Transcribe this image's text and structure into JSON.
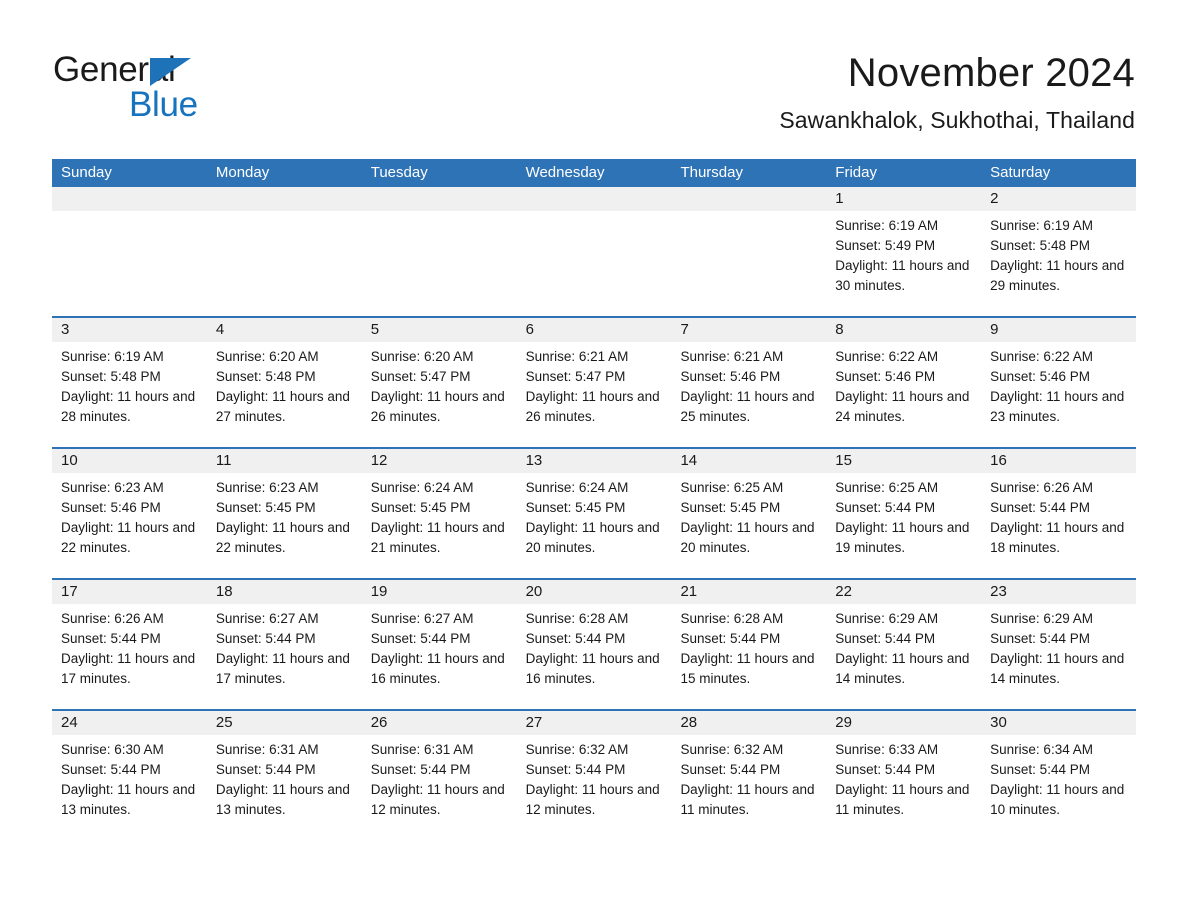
{
  "brand": {
    "name_part1": "General",
    "name_part2": "Blue",
    "logo_icon": "triangle-flag-icon"
  },
  "header": {
    "month_title": "November 2024",
    "location": "Sawankhalok, Sukhothai, Thailand"
  },
  "colors": {
    "header_blue": "#2e73b6",
    "brand_blue": "#1673be",
    "date_band_gray": "#f0f0f0",
    "text": "#1a1a1a"
  },
  "weekdays": [
    "Sunday",
    "Monday",
    "Tuesday",
    "Wednesday",
    "Thursday",
    "Friday",
    "Saturday"
  ],
  "labels": {
    "sunrise_prefix": "Sunrise:",
    "sunset_prefix": "Sunset:",
    "daylight_prefix": "Daylight:"
  },
  "weeks": [
    [
      {
        "date": "",
        "empty": true
      },
      {
        "date": "",
        "empty": true
      },
      {
        "date": "",
        "empty": true
      },
      {
        "date": "",
        "empty": true
      },
      {
        "date": "",
        "empty": true
      },
      {
        "date": "1",
        "sunrise": "Sunrise: 6:19 AM",
        "sunset": "Sunset: 5:49 PM",
        "daylight": "Daylight: 11 hours and 30 minutes."
      },
      {
        "date": "2",
        "sunrise": "Sunrise: 6:19 AM",
        "sunset": "Sunset: 5:48 PM",
        "daylight": "Daylight: 11 hours and 29 minutes."
      }
    ],
    [
      {
        "date": "3",
        "sunrise": "Sunrise: 6:19 AM",
        "sunset": "Sunset: 5:48 PM",
        "daylight": "Daylight: 11 hours and 28 minutes."
      },
      {
        "date": "4",
        "sunrise": "Sunrise: 6:20 AM",
        "sunset": "Sunset: 5:48 PM",
        "daylight": "Daylight: 11 hours and 27 minutes."
      },
      {
        "date": "5",
        "sunrise": "Sunrise: 6:20 AM",
        "sunset": "Sunset: 5:47 PM",
        "daylight": "Daylight: 11 hours and 26 minutes."
      },
      {
        "date": "6",
        "sunrise": "Sunrise: 6:21 AM",
        "sunset": "Sunset: 5:47 PM",
        "daylight": "Daylight: 11 hours and 26 minutes."
      },
      {
        "date": "7",
        "sunrise": "Sunrise: 6:21 AM",
        "sunset": "Sunset: 5:46 PM",
        "daylight": "Daylight: 11 hours and 25 minutes."
      },
      {
        "date": "8",
        "sunrise": "Sunrise: 6:22 AM",
        "sunset": "Sunset: 5:46 PM",
        "daylight": "Daylight: 11 hours and 24 minutes."
      },
      {
        "date": "9",
        "sunrise": "Sunrise: 6:22 AM",
        "sunset": "Sunset: 5:46 PM",
        "daylight": "Daylight: 11 hours and 23 minutes."
      }
    ],
    [
      {
        "date": "10",
        "sunrise": "Sunrise: 6:23 AM",
        "sunset": "Sunset: 5:46 PM",
        "daylight": "Daylight: 11 hours and 22 minutes."
      },
      {
        "date": "11",
        "sunrise": "Sunrise: 6:23 AM",
        "sunset": "Sunset: 5:45 PM",
        "daylight": "Daylight: 11 hours and 22 minutes."
      },
      {
        "date": "12",
        "sunrise": "Sunrise: 6:24 AM",
        "sunset": "Sunset: 5:45 PM",
        "daylight": "Daylight: 11 hours and 21 minutes."
      },
      {
        "date": "13",
        "sunrise": "Sunrise: 6:24 AM",
        "sunset": "Sunset: 5:45 PM",
        "daylight": "Daylight: 11 hours and 20 minutes."
      },
      {
        "date": "14",
        "sunrise": "Sunrise: 6:25 AM",
        "sunset": "Sunset: 5:45 PM",
        "daylight": "Daylight: 11 hours and 20 minutes."
      },
      {
        "date": "15",
        "sunrise": "Sunrise: 6:25 AM",
        "sunset": "Sunset: 5:44 PM",
        "daylight": "Daylight: 11 hours and 19 minutes."
      },
      {
        "date": "16",
        "sunrise": "Sunrise: 6:26 AM",
        "sunset": "Sunset: 5:44 PM",
        "daylight": "Daylight: 11 hours and 18 minutes."
      }
    ],
    [
      {
        "date": "17",
        "sunrise": "Sunrise: 6:26 AM",
        "sunset": "Sunset: 5:44 PM",
        "daylight": "Daylight: 11 hours and 17 minutes."
      },
      {
        "date": "18",
        "sunrise": "Sunrise: 6:27 AM",
        "sunset": "Sunset: 5:44 PM",
        "daylight": "Daylight: 11 hours and 17 minutes."
      },
      {
        "date": "19",
        "sunrise": "Sunrise: 6:27 AM",
        "sunset": "Sunset: 5:44 PM",
        "daylight": "Daylight: 11 hours and 16 minutes."
      },
      {
        "date": "20",
        "sunrise": "Sunrise: 6:28 AM",
        "sunset": "Sunset: 5:44 PM",
        "daylight": "Daylight: 11 hours and 16 minutes."
      },
      {
        "date": "21",
        "sunrise": "Sunrise: 6:28 AM",
        "sunset": "Sunset: 5:44 PM",
        "daylight": "Daylight: 11 hours and 15 minutes."
      },
      {
        "date": "22",
        "sunrise": "Sunrise: 6:29 AM",
        "sunset": "Sunset: 5:44 PM",
        "daylight": "Daylight: 11 hours and 14 minutes."
      },
      {
        "date": "23",
        "sunrise": "Sunrise: 6:29 AM",
        "sunset": "Sunset: 5:44 PM",
        "daylight": "Daylight: 11 hours and 14 minutes."
      }
    ],
    [
      {
        "date": "24",
        "sunrise": "Sunrise: 6:30 AM",
        "sunset": "Sunset: 5:44 PM",
        "daylight": "Daylight: 11 hours and 13 minutes."
      },
      {
        "date": "25",
        "sunrise": "Sunrise: 6:31 AM",
        "sunset": "Sunset: 5:44 PM",
        "daylight": "Daylight: 11 hours and 13 minutes."
      },
      {
        "date": "26",
        "sunrise": "Sunrise: 6:31 AM",
        "sunset": "Sunset: 5:44 PM",
        "daylight": "Daylight: 11 hours and 12 minutes."
      },
      {
        "date": "27",
        "sunrise": "Sunrise: 6:32 AM",
        "sunset": "Sunset: 5:44 PM",
        "daylight": "Daylight: 11 hours and 12 minutes."
      },
      {
        "date": "28",
        "sunrise": "Sunrise: 6:32 AM",
        "sunset": "Sunset: 5:44 PM",
        "daylight": "Daylight: 11 hours and 11 minutes."
      },
      {
        "date": "29",
        "sunrise": "Sunrise: 6:33 AM",
        "sunset": "Sunset: 5:44 PM",
        "daylight": "Daylight: 11 hours and 11 minutes."
      },
      {
        "date": "30",
        "sunrise": "Sunrise: 6:34 AM",
        "sunset": "Sunset: 5:44 PM",
        "daylight": "Daylight: 11 hours and 10 minutes."
      }
    ]
  ]
}
